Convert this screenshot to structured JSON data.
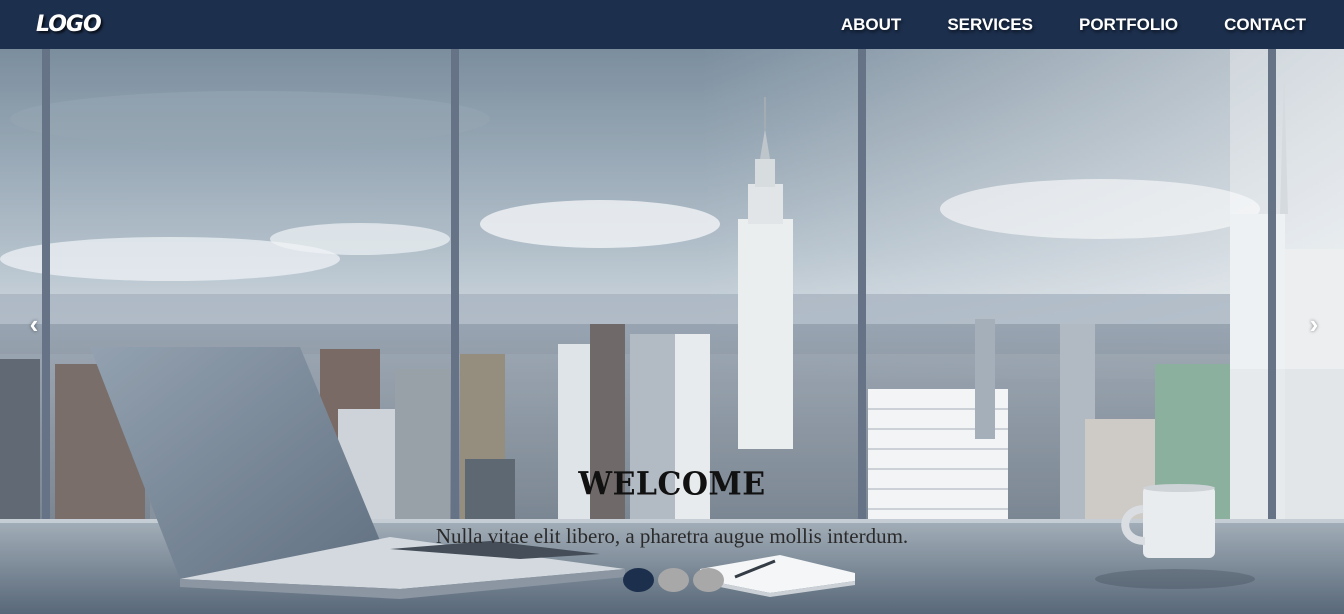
{
  "navbar": {
    "logo": "LOGO",
    "links": [
      "ABOUT",
      "SERVICES",
      "PORTFOLIO",
      "CONTACT"
    ]
  },
  "carousel": {
    "prev_icon": "‹",
    "next_icon": "›",
    "caption_title": "WELCOME",
    "caption_text": "Nulla vitae elit libero, a pharetra augue mollis interdum.",
    "slide_count": 3,
    "active_slide": 1
  },
  "colors": {
    "navbar_bg": "#1c2f4d",
    "indicator_active": "#1c2f4d",
    "indicator_inactive": "#a9a8a8"
  }
}
